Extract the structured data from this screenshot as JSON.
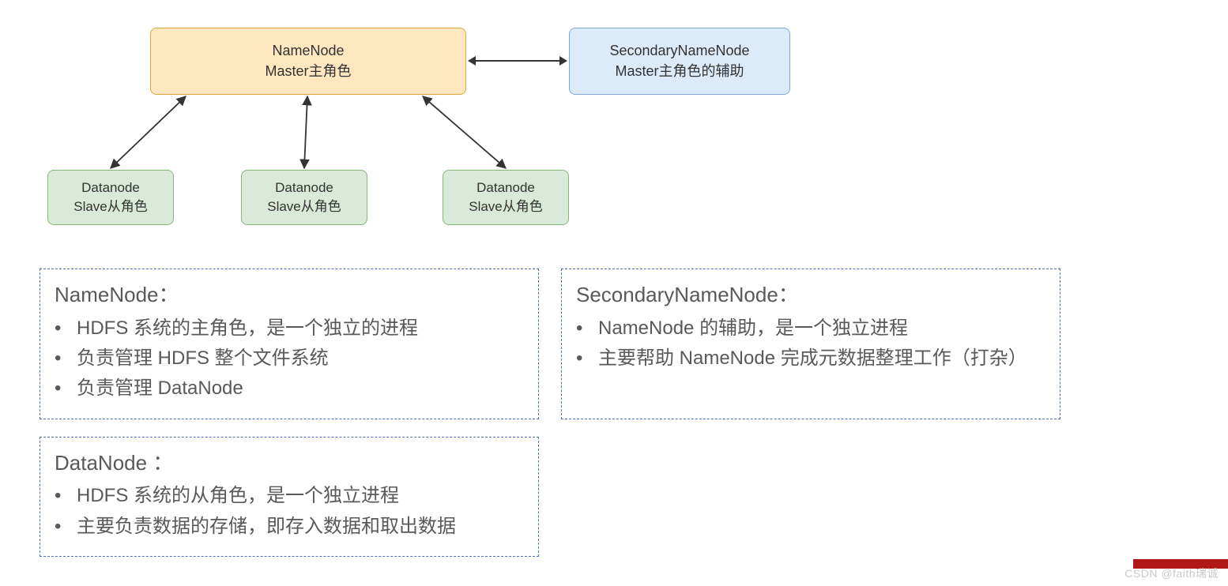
{
  "nodes": {
    "namenode": {
      "title": "NameNode",
      "subtitle": "Master主角色"
    },
    "secondary": {
      "title": "SecondaryNameNode",
      "subtitle": "Master主角色的辅助"
    },
    "datanode": {
      "title": "Datanode",
      "subtitle": "Slave从角色"
    }
  },
  "panels": {
    "namenode": {
      "title": "NameNode：",
      "items": [
        "HDFS 系统的主角色，是一个独立的进程",
        "负责管理 HDFS 整个文件系统",
        "负责管理 DataNode"
      ]
    },
    "secondary": {
      "title": "SecondaryNameNode：",
      "items": [
        "NameNode 的辅助，是一个独立进程",
        "主要帮助 NameNode 完成元数据整理工作（打杂）"
      ]
    },
    "datanode": {
      "title": "DataNode ：",
      "items": [
        "HDFS 系统的从角色，是一个独立进程",
        "主要负责数据的存储，即存入数据和取出数据"
      ]
    }
  },
  "watermark": "CSDN @faith瑞诚",
  "colors": {
    "namenode_bg": "#ffe8bf",
    "namenode_border": "#e3a53a",
    "secondary_bg": "#dcebfa",
    "secondary_border": "#7fa8d6",
    "datanode_bg": "#d9ead8",
    "datanode_border": "#88b57a",
    "panel_border": "#4f6fbf",
    "text": "#595959"
  }
}
